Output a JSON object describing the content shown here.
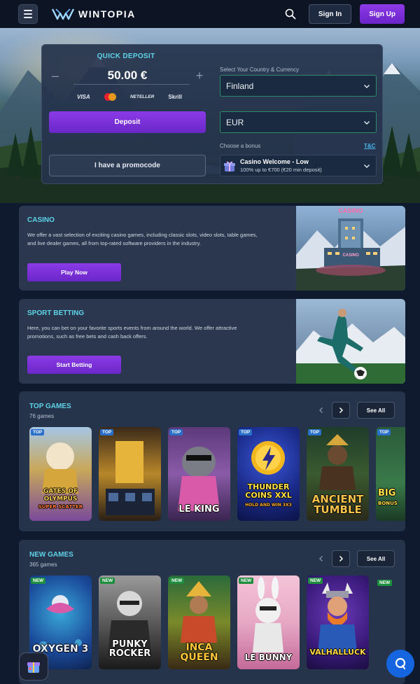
{
  "header": {
    "brand": "WINTOPIA",
    "signin_label": "Sign In",
    "signup_label": "Sign Up"
  },
  "deposit": {
    "title": "QUICK DEPOSIT",
    "amount": "50.00 €",
    "minus": "–",
    "plus": "+",
    "payment_methods": [
      "VISA",
      "NETELLER",
      "Skrill"
    ],
    "deposit_label": "Deposit",
    "promo_label": "I have a promocode",
    "country_label": "Select Your Country & Currency",
    "country_value": "Finland",
    "currency_value": "EUR",
    "bonus_label": "Choose a bonus",
    "tnc_label": "T&C",
    "bonus_title": "Casino Welcome - Low",
    "bonus_sub": "100% up to €700 (€20 min deposit)"
  },
  "casino_card": {
    "title": "CASINO",
    "text": "We offer a vast selection of exciting casino games, including classic slots, video slots, table games, and live dealer games, all from top-rated software providers in the industry.",
    "button": "Play Now",
    "sign_top": "CASINO",
    "sign_mid": "CASINO"
  },
  "sport_card": {
    "title": "SPORT BETTING",
    "text": "Here, you can bet on your favorite sports events from around the world. We offer attractive promotions, such as free bets and cash back offers.",
    "button": "Start Betting"
  },
  "top_games": {
    "title": "TOP GAMES",
    "count": "76 games",
    "see_all": "See All",
    "tag": "TOP",
    "games": [
      {
        "name": "GATES OF OLYMPUS",
        "sub": "SUPER SCATTER"
      },
      {
        "name": "",
        "sub": ""
      },
      {
        "name": "LE KING",
        "sub": ""
      },
      {
        "name": "THUNDER COINS XXL",
        "sub": "HOLD AND WIN 3X3"
      },
      {
        "name": "ANCIENT TUMBLE",
        "sub": ""
      },
      {
        "name": "BIG",
        "sub": "BONUS"
      }
    ]
  },
  "new_games": {
    "title": "NEW GAMES",
    "count": "365 games",
    "see_all": "See All",
    "tag": "NEW",
    "games": [
      {
        "name": "OXYGEN 3",
        "sub": ""
      },
      {
        "name": "PUNKY ROCKER",
        "sub": ""
      },
      {
        "name": "INCA QUEEN",
        "sub": ""
      },
      {
        "name": "LE BUNNY",
        "sub": ""
      },
      {
        "name": "VALHALLUCK",
        "sub": ""
      }
    ]
  },
  "colors": {
    "accent_purple": "#7c30d9",
    "accent_cyan": "#5fd3e8",
    "link_blue": "#49b8f0",
    "chat_blue": "#1565e0"
  }
}
